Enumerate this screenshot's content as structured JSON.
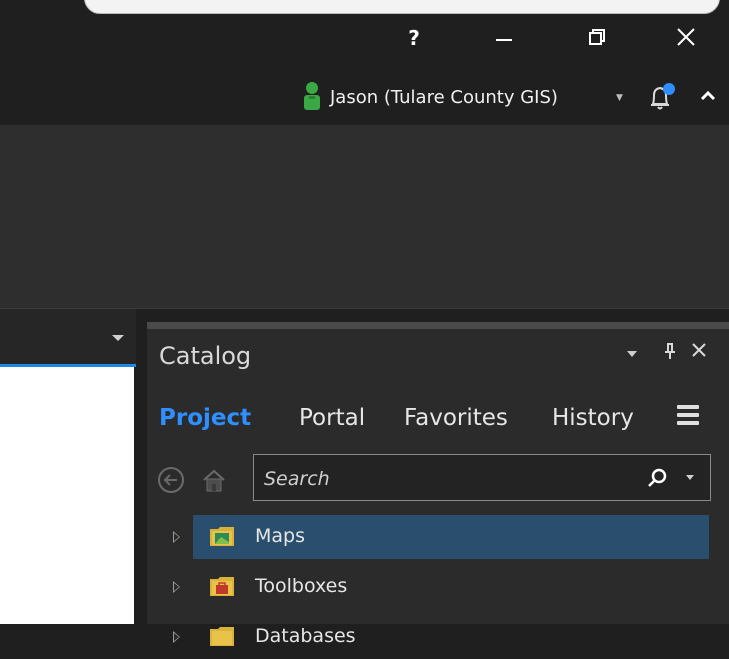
{
  "titlebar": {
    "help": "?"
  },
  "user": {
    "name": "Jason (Tulare County GIS)"
  },
  "catalog": {
    "title": "Catalog",
    "tabs": [
      "Project",
      "Portal",
      "Favorites",
      "History"
    ],
    "search": {
      "placeholder": "Search",
      "value": ""
    },
    "items": [
      {
        "label": "Maps",
        "icon": "maps-folder-icon",
        "selected": true
      },
      {
        "label": "Toolboxes",
        "icon": "toolbox-folder-icon",
        "selected": false
      },
      {
        "label": "Databases",
        "icon": "database-folder-icon",
        "selected": false
      }
    ]
  },
  "colors": {
    "accent": "#2f8fff",
    "selection": "#294e6e",
    "titlebar": "#1f1f1f",
    "ribbon": "#2e2e2e",
    "pane": "#2b2b2b"
  }
}
